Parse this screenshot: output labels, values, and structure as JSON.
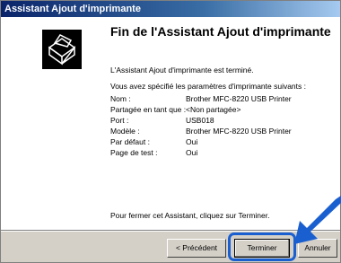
{
  "window": {
    "title": "Assistant Ajout d'imprimante"
  },
  "content": {
    "heading": "Fin de l'Assistant Ajout d'imprimante",
    "completed_text": "L'Assistant Ajout d'imprimante est terminé.",
    "params_intro": "Vous avez spécifié les paramètres d'imprimante suivants :",
    "params": [
      {
        "label": "Nom :",
        "value": "Brother MFC-8220 USB Printer"
      },
      {
        "label": "Partagée en tant que :",
        "value": "<Non partagée>"
      },
      {
        "label": "Port :",
        "value": "USB018"
      },
      {
        "label": "Modèle :",
        "value": "Brother MFC-8220 USB Printer"
      },
      {
        "label": "Par défaut :",
        "value": "Oui"
      },
      {
        "label": "Page de test :",
        "value": "Oui"
      }
    ],
    "close_text": "Pour fermer cet Assistant, cliquez sur Terminer."
  },
  "buttons": {
    "back": "< Précédent",
    "finish": "Terminer",
    "cancel": "Annuler"
  },
  "icon": "printer-icon",
  "accent_color": "#1a5fd0"
}
